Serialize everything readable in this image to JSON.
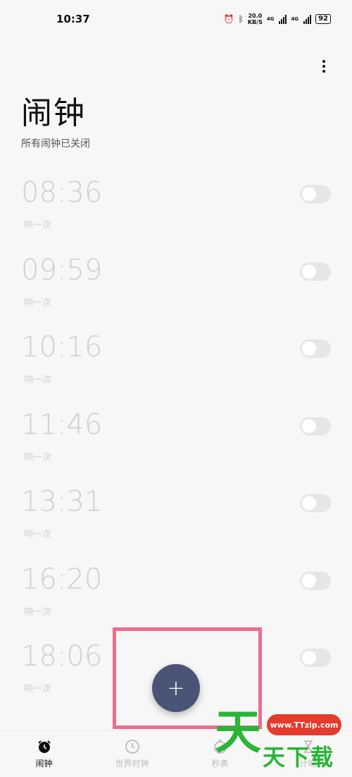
{
  "status_bar": {
    "time": "10:37",
    "net_speed_value": "20.0",
    "net_speed_unit": "KB/S",
    "network_1": "4G",
    "network_2": "4G",
    "battery": "92"
  },
  "header": {
    "title": "闹钟",
    "subtitle": "所有闹钟已关闭"
  },
  "alarms": [
    {
      "time": "08:36",
      "repeat": "响一次",
      "enabled": false
    },
    {
      "time": "09:59",
      "repeat": "响一次",
      "enabled": false
    },
    {
      "time": "10:16",
      "repeat": "响一次",
      "enabled": false
    },
    {
      "time": "11:46",
      "repeat": "响一次",
      "enabled": false
    },
    {
      "time": "13:31",
      "repeat": "响一次",
      "enabled": false
    },
    {
      "time": "16:20",
      "repeat": "响一次",
      "enabled": false
    },
    {
      "time": "18:06",
      "repeat": "响一次",
      "enabled": false
    }
  ],
  "fab": {
    "icon": "plus-icon",
    "label": "+"
  },
  "bottom_nav": [
    {
      "label": "闹钟",
      "icon": "alarm-clock-icon",
      "active": true
    },
    {
      "label": "世界时钟",
      "icon": "clock-icon",
      "active": false
    },
    {
      "label": "秒表",
      "icon": "stopwatch-icon",
      "active": false
    },
    {
      "label": "计时",
      "icon": "timer-icon",
      "active": false
    }
  ],
  "watermark": {
    "url": "www.TTzip.com",
    "big_char": "天",
    "chars": "天下载"
  },
  "colors": {
    "fab": "#4a5576",
    "highlight": "#f06b8d",
    "watermark_green": "#29b536",
    "watermark_red": "#e33b2c"
  }
}
